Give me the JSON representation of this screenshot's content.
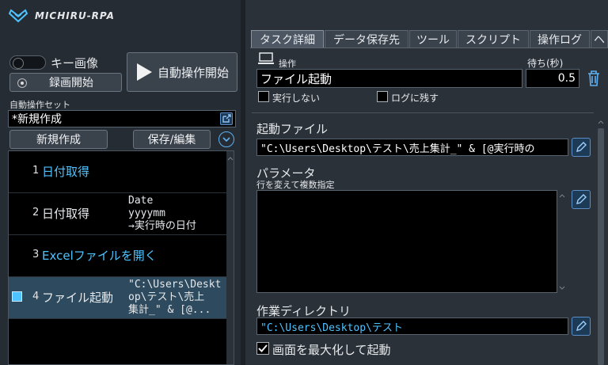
{
  "app": {
    "logo_text": "MICHIRU-RPA"
  },
  "left": {
    "key_image_label": "キー画像",
    "record_start_label": "録画開始",
    "auto_start_label": "自動操作開始",
    "set_label": "自動操作セット",
    "set_value": "*新規作成",
    "new_label": "新規作成",
    "save_edit_label": "保存/編集"
  },
  "tasks": [
    {
      "num": "1",
      "name": "日付取得",
      "detail": ""
    },
    {
      "num": "2",
      "name": "日付取得",
      "detail": "Date\nyyyymm\n→実行時の日付"
    },
    {
      "num": "3",
      "name": "Excelファイルを開く",
      "detail": ""
    },
    {
      "num": "4",
      "name": "ファイル起動",
      "detail": "\"C:\\Users\\Deskt\nop\\テスト\\売上\n集計_\" & [@..."
    }
  ],
  "tabs": [
    "タスク詳細",
    "データ保存先",
    "ツール",
    "スクリプト",
    "操作ログ",
    "ヘ"
  ],
  "detail": {
    "op_label": "操作",
    "op_value": "ファイル起動",
    "wait_label": "待ち(秒)",
    "wait_value": "0.5",
    "no_exec_label": "実行しない",
    "keep_log_label": "ログに残す",
    "file_label": "起動ファイル",
    "file_value": "\"C:\\Users\\Desktop\\テスト\\売上集計_\" & [@実行時の",
    "param_label": "パラメータ",
    "param_hint": "行を変えて複数指定",
    "workdir_label": "作業ディレクトリ",
    "workdir_value": "\"C:\\Users\\Desktop\\テスト",
    "maximize_label": "画面を最大化して起動"
  },
  "colors": {
    "accent": "#4fc3ff",
    "selected_row": "#2e4a5e"
  }
}
